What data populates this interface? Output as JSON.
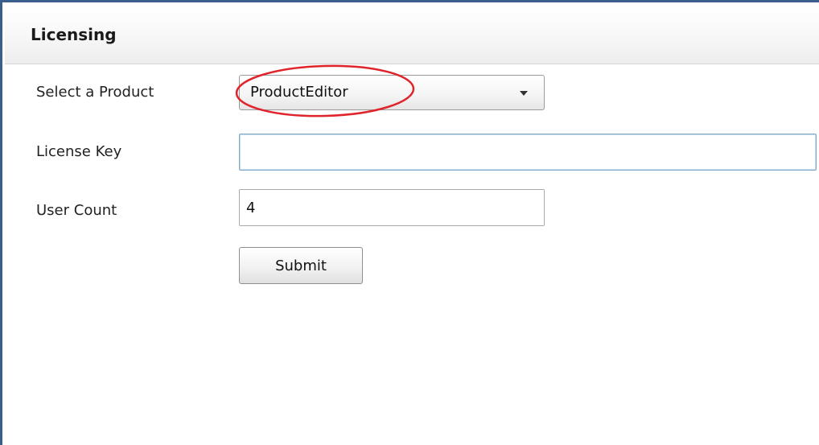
{
  "header": {
    "title": "Licensing"
  },
  "form": {
    "product": {
      "label": "Select a Product",
      "selected_value": "ProductEditor"
    },
    "license_key": {
      "label": "License Key",
      "value": ""
    },
    "user_count": {
      "label": "User Count",
      "value": "4"
    },
    "submit_label": "Submit"
  },
  "colors": {
    "frame_border": "#3a5f8c",
    "highlight_annotation": "#e0242c",
    "focused_input_border": "#7fa9c9"
  }
}
